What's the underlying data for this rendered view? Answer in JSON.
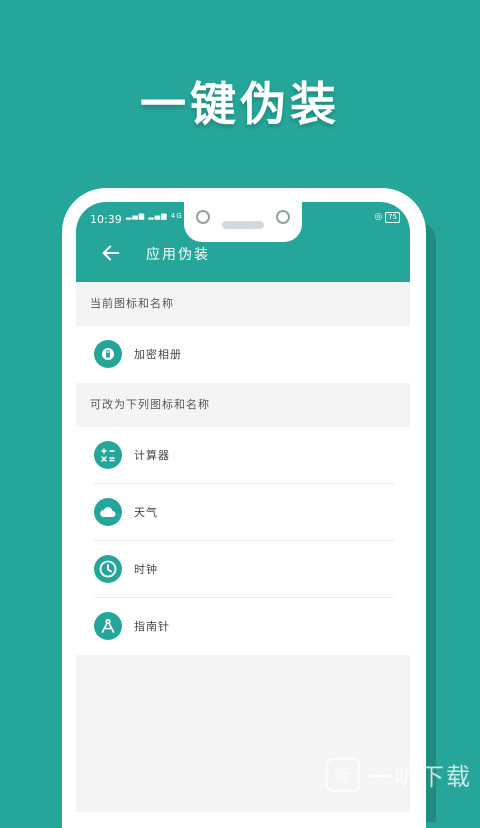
{
  "hero": {
    "title": "一键伪装"
  },
  "status_bar": {
    "time": "10:39",
    "network": "4G",
    "battery": "75"
  },
  "app_bar": {
    "title": "应用伪装"
  },
  "current_section": {
    "header": "当前图标和名称",
    "item": {
      "label": "加密相册",
      "icon": "lock-icon"
    }
  },
  "options_section": {
    "header": "可改为下列图标和名称",
    "items": [
      {
        "label": "计算器",
        "icon": "calculator-icon"
      },
      {
        "label": "天气",
        "icon": "cloud-icon"
      },
      {
        "label": "时钟",
        "icon": "clock-icon"
      },
      {
        "label": "指南针",
        "icon": "compass-icon"
      }
    ]
  },
  "watermark": {
    "logo": "听",
    "text": "一听下载"
  },
  "colors": {
    "accent": "#26a69a",
    "background": "#f4f4f4"
  }
}
